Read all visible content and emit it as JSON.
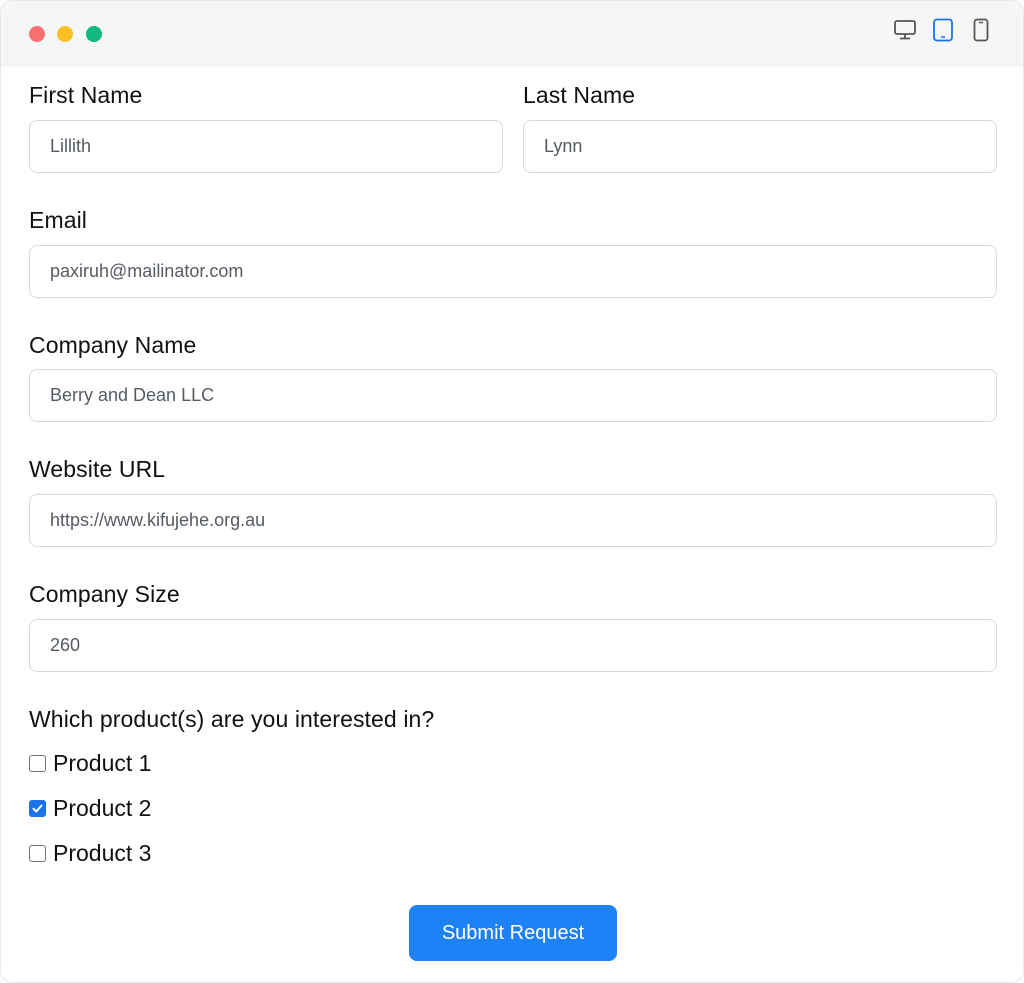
{
  "window": {
    "traffic_lights": [
      "red",
      "yellow",
      "green"
    ],
    "colors": {
      "red": "#f87171",
      "yellow": "#fbbf24",
      "green": "#10b981",
      "active_device": "#1a73e8"
    },
    "device_toggle": {
      "options": [
        "desktop-icon",
        "tablet-icon",
        "mobile-icon"
      ],
      "selected": "tablet-icon"
    }
  },
  "form": {
    "first_name": {
      "label": "First Name",
      "value": "Lillith"
    },
    "last_name": {
      "label": "Last Name",
      "value": "Lynn"
    },
    "email": {
      "label": "Email",
      "value": "paxiruh@mailinator.com"
    },
    "company_name": {
      "label": "Company Name",
      "value": "Berry and Dean LLC"
    },
    "website": {
      "label": "Website URL",
      "value": "https://www.kifujehe.org.au"
    },
    "company_size": {
      "label": "Company Size",
      "value": "260"
    },
    "products": {
      "label": "Which product(s) are you interested in?",
      "options": [
        {
          "label": "Product 1",
          "checked": false
        },
        {
          "label": "Product 2",
          "checked": true
        },
        {
          "label": "Product 3",
          "checked": false
        }
      ]
    },
    "submit_label": "Submit Request",
    "submit_color": "#1d82f5"
  }
}
